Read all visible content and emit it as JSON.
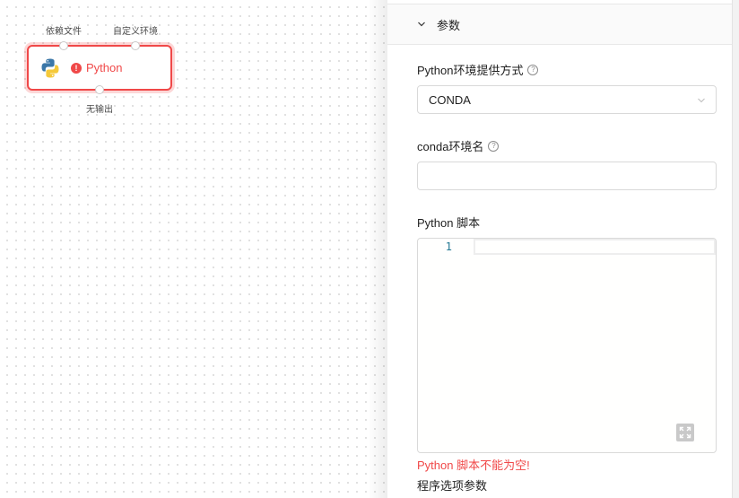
{
  "canvas": {
    "node": {
      "title": "Python",
      "icon": "python-logo-icon",
      "status": "error",
      "input_ports": [
        {
          "label": "依赖文件"
        },
        {
          "label": "自定义环境"
        }
      ],
      "output_port": {
        "label": "无输出"
      }
    }
  },
  "panel": {
    "section_title": "参数",
    "env_provider": {
      "label": "Python环境提供方式",
      "value": "CONDA"
    },
    "conda_env": {
      "label": "conda环境名",
      "value": "",
      "placeholder": ""
    },
    "script": {
      "label": "Python 脚本",
      "line_numbers": [
        "1"
      ],
      "error": "Python 脚本不能为空!"
    },
    "next_section_label": "程序选项参数"
  },
  "colors": {
    "error": "#f04848",
    "border": "#d9d9d9",
    "line_number": "#237893"
  }
}
